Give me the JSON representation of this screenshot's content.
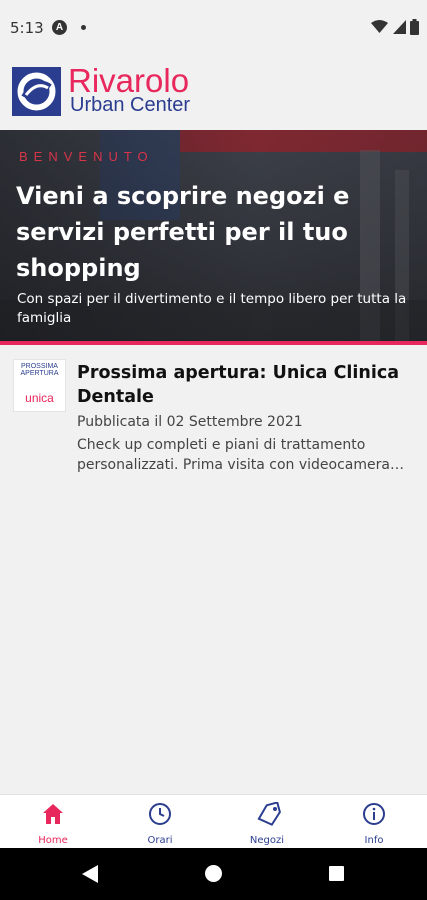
{
  "status_bar": {
    "time": "5:13",
    "badge_letter": "A"
  },
  "brand": {
    "name_line1": "Rivarolo",
    "name_line2": "Urban Center",
    "primary_color": "#e8275c",
    "secondary_color": "#2a3d8f"
  },
  "hero": {
    "eyebrow": "BENVENUTO",
    "title": "Vieni a scoprire negozi e servizi perfetti per il tuo shopping",
    "subtitle": "Con spazi per il divertimento e il tempo libero per tutta la famiglia"
  },
  "news": [
    {
      "thumb_top": "PROSSIMA APERTURA",
      "thumb_bottom": "unica",
      "title": "Prossima apertura: Unica Clinica Dentale",
      "date": "Pubblicata il 02 Settembre 2021",
      "excerpt": "Check up completi e piani di trattamento personalizzati. Prima visita con videocamera intraorale gratuita"
    }
  ],
  "bottom_nav": {
    "active_color": "#e8275c",
    "inactive_color": "#2a3d8f",
    "items": [
      {
        "label": "Home",
        "icon": "home-icon",
        "active": true
      },
      {
        "label": "Orari",
        "icon": "clock-icon",
        "active": false
      },
      {
        "label": "Negozi",
        "icon": "tag-icon",
        "active": false
      },
      {
        "label": "Info",
        "icon": "info-icon",
        "active": false
      }
    ]
  }
}
